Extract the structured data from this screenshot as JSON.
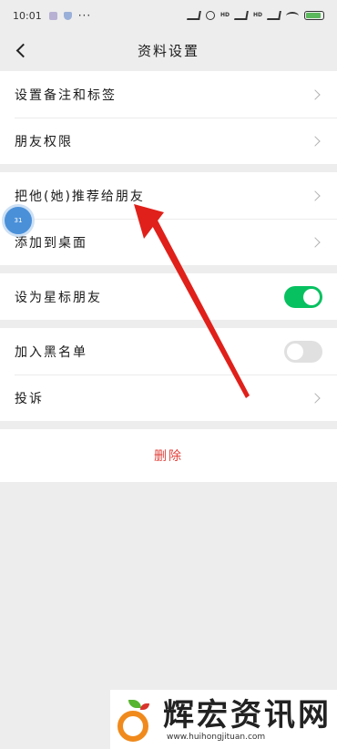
{
  "status_bar": {
    "time": "10:01",
    "more": "···",
    "hd1": "HD",
    "hd2": "HD",
    "battery_level": 0.9,
    "battery_color": "#5cb85c"
  },
  "header": {
    "title": "资料设置"
  },
  "groups": [
    {
      "rows": [
        {
          "label": "设置备注和标签"
        },
        {
          "label": "朋友权限"
        }
      ]
    },
    {
      "rows": [
        {
          "label": "把他(她)推荐给朋友"
        },
        {
          "label": "添加到桌面"
        }
      ]
    },
    {
      "rows": [
        {
          "label": "设为星标朋友",
          "toggle": "on"
        }
      ]
    },
    {
      "rows": [
        {
          "label": "加入黑名单",
          "toggle": "off"
        },
        {
          "label": "投诉"
        }
      ]
    }
  ],
  "delete_label": "删除",
  "float_ball_text": "31",
  "watermark": {
    "title": "辉宏资讯网",
    "url": "www.huihongjituan.com"
  },
  "colors": {
    "accent_green": "#07c160",
    "delete_red": "#e0413b",
    "arrow_red": "#e0201a"
  }
}
